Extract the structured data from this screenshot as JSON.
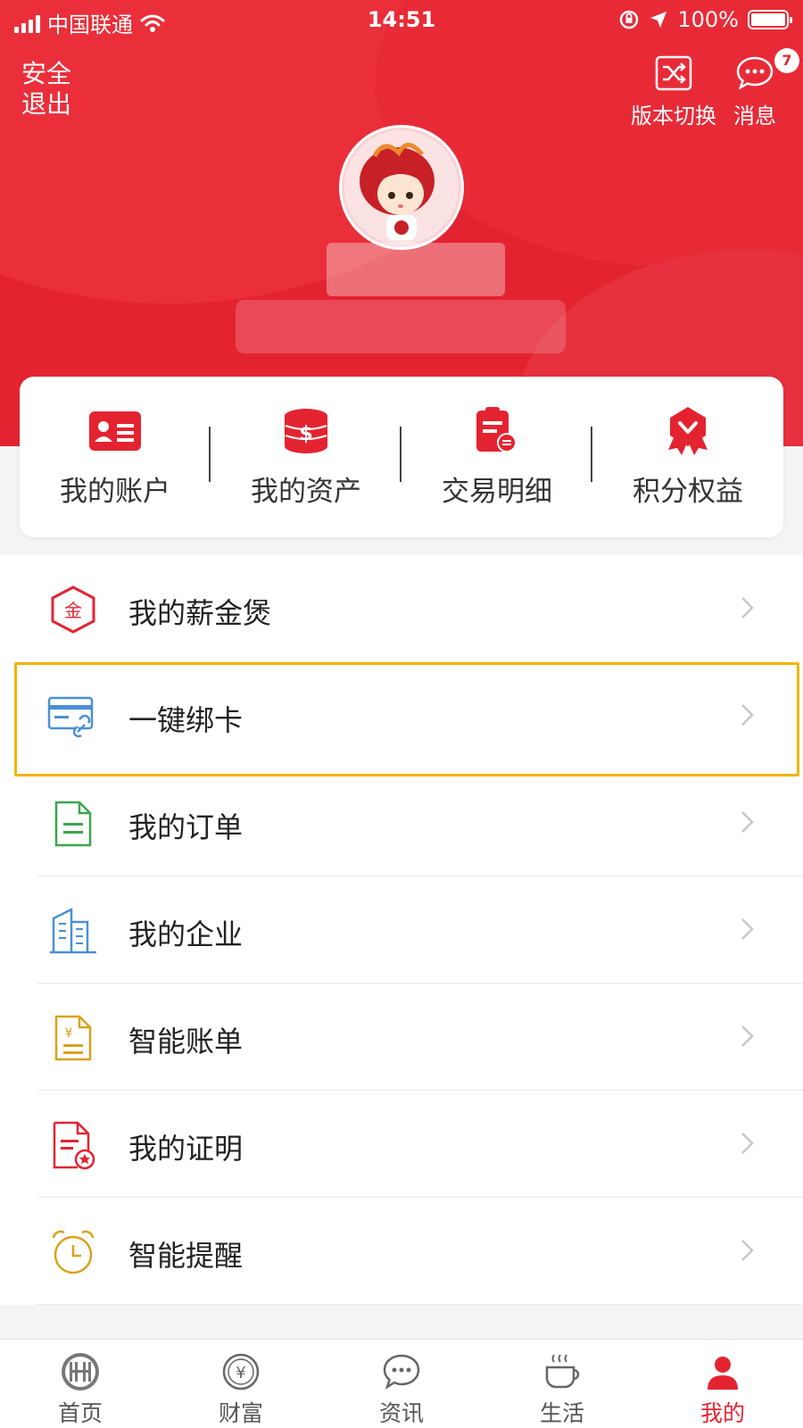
{
  "status_bar": {
    "carrier": "中国联通",
    "time": "14:51",
    "battery": "100%",
    "battery_level": 1.0
  },
  "header": {
    "logout_label": "安全\n退出",
    "version_switch_label": "版本切换",
    "messages_label": "消息",
    "messages_count": "7"
  },
  "quick_actions": [
    {
      "label": "我的账户",
      "icon": "id-card-icon"
    },
    {
      "label": "我的资产",
      "icon": "coin-stack-icon"
    },
    {
      "label": "交易明细",
      "icon": "transaction-list-icon"
    },
    {
      "label": "积分权益",
      "icon": "award-ribbon-icon"
    }
  ],
  "menu": [
    {
      "label": "我的薪金煲",
      "icon": "gold-hexagon-icon",
      "icon_text": "金"
    },
    {
      "label": "一键绑卡",
      "icon": "card-link-icon"
    },
    {
      "label": "我的订单",
      "icon": "order-document-icon"
    },
    {
      "label": "我的企业",
      "icon": "building-icon"
    },
    {
      "label": "智能账单",
      "icon": "yuan-bill-icon",
      "icon_text": "¥"
    },
    {
      "label": "我的证明",
      "icon": "certificate-icon"
    },
    {
      "label": "智能提醒",
      "icon": "alarm-clock-icon"
    }
  ],
  "tabs": [
    {
      "label": "首页",
      "icon": "home-logo-icon"
    },
    {
      "label": "财富",
      "icon": "yuan-coin-icon",
      "icon_text": "¥"
    },
    {
      "label": "资讯",
      "icon": "chat-bubble-icon"
    },
    {
      "label": "生活",
      "icon": "coffee-cup-icon"
    },
    {
      "label": "我的",
      "icon": "user-icon",
      "active": true
    }
  ],
  "colors": {
    "brand_red": "#e42331",
    "highlight_border": "#f4b400",
    "order_green": "#3aa64b",
    "enterprise_blue": "#4a8fd6",
    "bill_gold": "#d9a21b"
  }
}
